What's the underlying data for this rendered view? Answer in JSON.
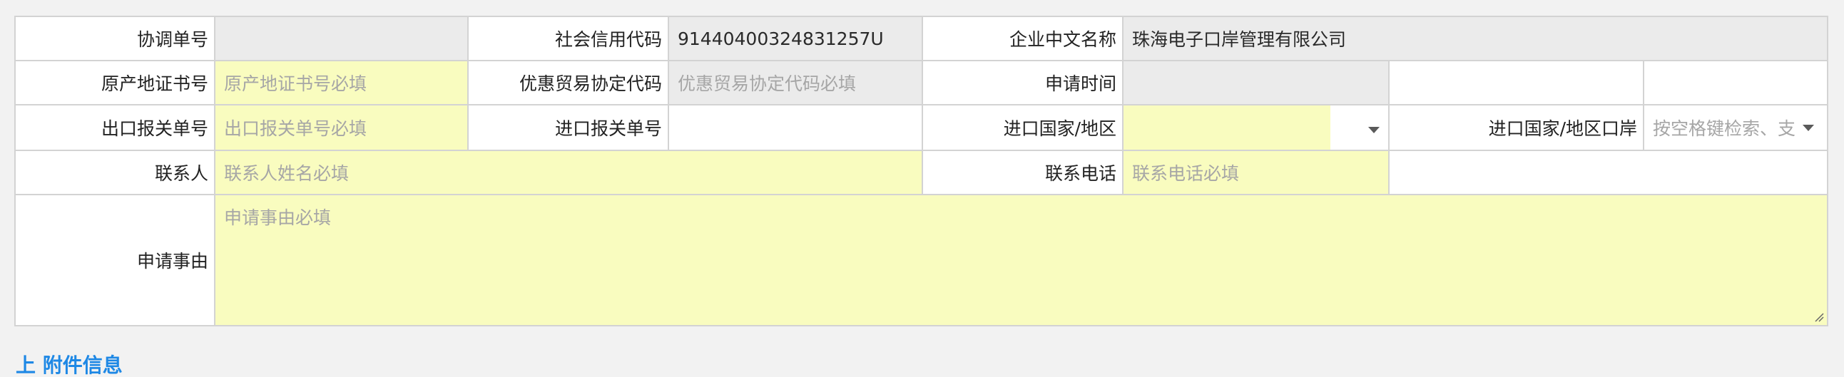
{
  "form": {
    "row1": {
      "coord_no_label": "协调单号",
      "coord_no_value": "",
      "credit_code_label": "社会信用代码",
      "credit_code_value": "91440400324831257U",
      "company_name_label": "企业中文名称",
      "company_name_value": "珠海电子口岸管理有限公司"
    },
    "row2": {
      "origin_cert_label": "原产地证书号",
      "origin_cert_placeholder": "原产地证书号必填",
      "trade_agreement_label": "优惠贸易协定代码",
      "trade_agreement_placeholder": "优惠贸易协定代码必填",
      "apply_time_label": "申请时间",
      "apply_time_value": ""
    },
    "row3": {
      "export_decl_label": "出口报关单号",
      "export_decl_placeholder": "出口报关单号必填",
      "import_decl_label": "进口报关单号",
      "import_decl_value": "",
      "import_country_label": "进口国家/地区",
      "import_country_value": "",
      "import_port_label": "进口国家/地区口岸",
      "import_port_placeholder": "按空格键检索、支"
    },
    "row4": {
      "contact_label": "联系人",
      "contact_placeholder": "联系人姓名必填",
      "phone_label": "联系电话",
      "phone_placeholder": "联系电话必填"
    },
    "row5": {
      "reason_label": "申请事由",
      "reason_placeholder": "申请事由必填"
    }
  },
  "section": {
    "title": "上 附件信息"
  },
  "colors": {
    "required_bg": "#f9fcbf",
    "readonly_bg": "#ebebeb",
    "border": "#d3d3d3",
    "accent": "#1e88e5"
  },
  "icons": [
    "chevron-down-icon",
    "resize-handle-icon"
  ]
}
